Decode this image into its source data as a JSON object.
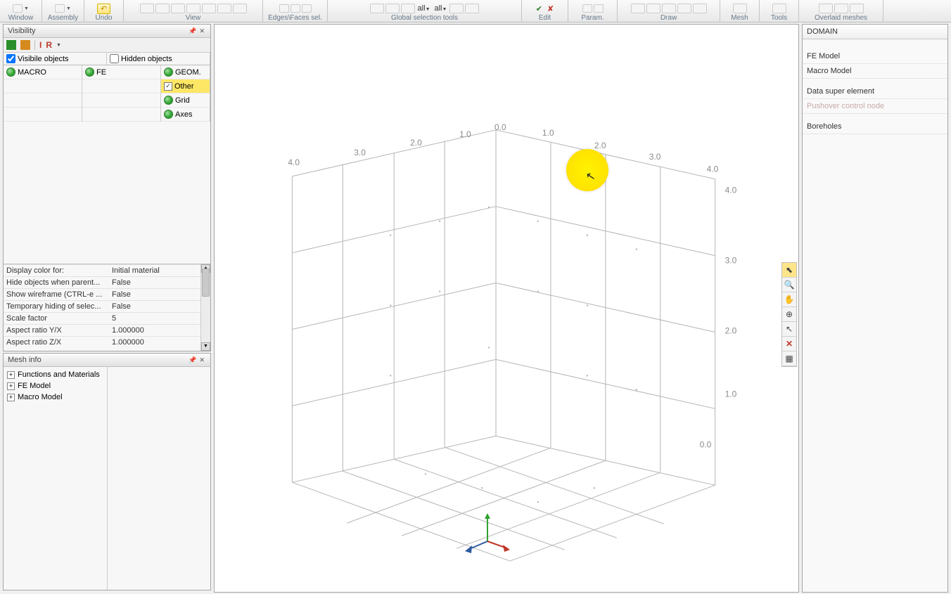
{
  "toolbar": {
    "window": "Window",
    "assembly": "Assembly",
    "undo": "Undo",
    "view": "View",
    "edges": "Edges\\Faces sel.",
    "selall1": "all",
    "selall2": "all",
    "global": "Global selection tools",
    "edit": "Edit",
    "param": "Param.",
    "draw": "Draw",
    "mesh": "Mesh",
    "tools": "Tools",
    "overlaid": "Overlaid meshes"
  },
  "panels": {
    "visibility_title": "Visibility",
    "mesh_info_title": "Mesh info",
    "visible_header": "Visibile objects",
    "hidden_header": "Hidden objects",
    "row_macro": "MACRO",
    "row_fe": "FE",
    "row_geom": "GEOM.",
    "row_other": "Other",
    "row_grid": "Grid",
    "row_axes": "Axes",
    "I": "I",
    "R": "R"
  },
  "props": [
    {
      "name": "Display color for:",
      "value": "Initial material"
    },
    {
      "name": "Hide objects when parent...",
      "value": "False"
    },
    {
      "name": "Show wireframe (CTRL-e ...",
      "value": "False"
    },
    {
      "name": "Temporary hiding of selec...",
      "value": "False"
    },
    {
      "name": "Scale factor",
      "value": "5"
    },
    {
      "name": "Aspect ratio Y/X",
      "value": "1.000000"
    },
    {
      "name": "Aspect ratio Z/X",
      "value": "1.000000"
    }
  ],
  "tree": {
    "functions": "Functions and Materials",
    "fe": "FE Model",
    "macro": "Macro Model"
  },
  "domain": {
    "title": "DOMAIN",
    "fe": "FE Model",
    "macro": "Macro Model",
    "super": "Data super element",
    "pushover": "Pushover control node",
    "boreholes": "Boreholes"
  },
  "axis_labels": {
    "left": [
      "4.0",
      "3.0",
      "2.0",
      "1.0",
      "0.0"
    ],
    "right_top": [
      "1.0",
      "2.0",
      "3.0",
      "4.0"
    ],
    "right_side": [
      "4.0",
      "3.0",
      "2.0",
      "1.0",
      "0.0"
    ]
  }
}
